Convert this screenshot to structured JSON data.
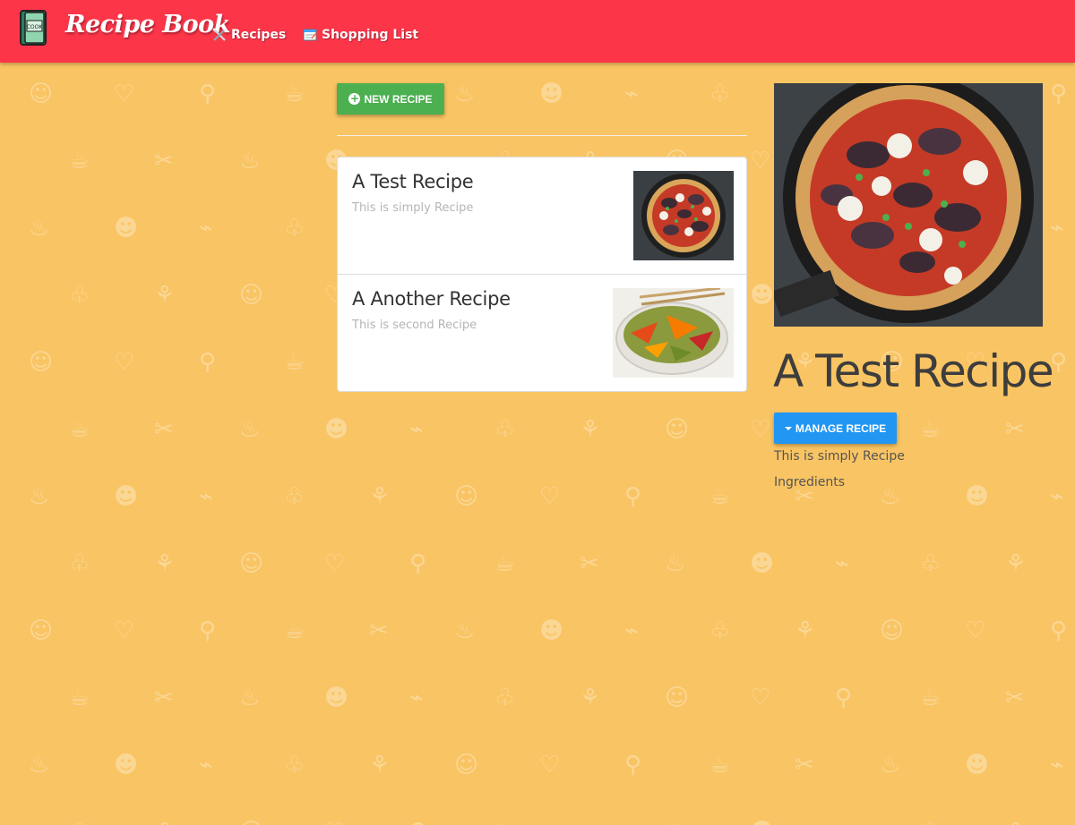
{
  "navbar": {
    "brand": "Recipe Book",
    "logo_icon": "cookbook-icon",
    "links": [
      {
        "label": "Recipes",
        "icon": "fork-knife-icon"
      },
      {
        "label": "Shopping List",
        "icon": "notepad-icon"
      }
    ],
    "color": "#fd3549"
  },
  "page": {
    "background": "#f9c463"
  },
  "list": {
    "new_button_label": "NEW RECIPE",
    "new_button_color": "#4caf50",
    "recipes": [
      {
        "name": "A Test Recipe",
        "description": "This is simply Recipe",
        "image": "pizza-image"
      },
      {
        "name": "A Another Recipe",
        "description": "This is second Recipe",
        "image": "salad-image"
      }
    ]
  },
  "detail": {
    "image": "pizza-image",
    "title": "A Test Recipe",
    "manage_button_label": "MANAGE RECIPE",
    "manage_button_color": "#2196f3",
    "description": "This is simply Recipe",
    "ingredients_label": "Ingredients"
  }
}
